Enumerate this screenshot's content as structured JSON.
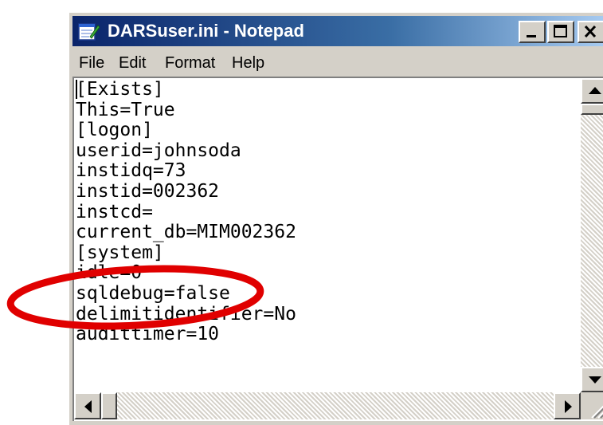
{
  "window": {
    "title": "DARSuser.ini - Notepad",
    "controls": {
      "minimize": "_",
      "maximize": "□",
      "close": "x"
    }
  },
  "menu": {
    "items": [
      "File",
      "Edit",
      "Format",
      "Help"
    ]
  },
  "editor": {
    "lines": [
      "[Exists]",
      "This=True",
      "[logon]",
      "userid=johnsoda",
      "instidq=73",
      "instid=002362",
      "instcd=",
      "current_db=MIM002362",
      "[system]",
      "idle=0",
      "sqldebug=false",
      "delimitidentifier=No",
      "audittimer=10"
    ]
  },
  "annotation": {
    "shape": "ellipse",
    "color": "#e00000",
    "highlights_line": "idle=0"
  },
  "colors": {
    "titlebar_start": "#0a246a",
    "titlebar_end": "#a6caf0",
    "chrome": "#d4d0c8"
  },
  "icons": [
    "notepad-icon",
    "scroll-up-icon",
    "scroll-down-icon",
    "scroll-left-icon",
    "scroll-right-icon",
    "resize-grip-icon"
  ]
}
